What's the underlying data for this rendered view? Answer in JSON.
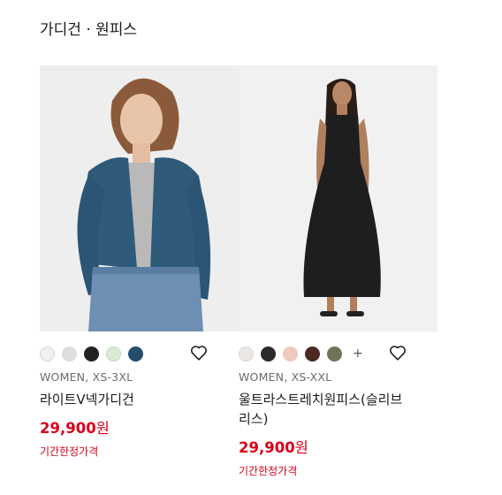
{
  "section": {
    "title": "가디건 · 원피스"
  },
  "products": [
    {
      "meta": "WOMEN, XS-3XL",
      "name": "라이트V넥가디건",
      "price": "29,900",
      "currency": "원",
      "badge": "기간한정가격",
      "swatches": [
        "#f1f1ef",
        "#dedede",
        "#222222",
        "#d9ebd5",
        "#244d6d"
      ],
      "more": ""
    },
    {
      "meta": "WOMEN, XS-XXL",
      "name": "울트라스트레치원피스(슬리브리스)",
      "price": "29,900",
      "currency": "원",
      "badge": "기간한정가격",
      "swatches": [
        "#ece8e4",
        "#2b2b2b",
        "#efc9bd",
        "#4a2a22",
        "#6d7458"
      ],
      "more": "+"
    }
  ],
  "colors": {
    "price": "#d9001b",
    "photo_bg": "#f0f0f0"
  },
  "icons": {
    "wishlist": "heart-outline-icon"
  }
}
